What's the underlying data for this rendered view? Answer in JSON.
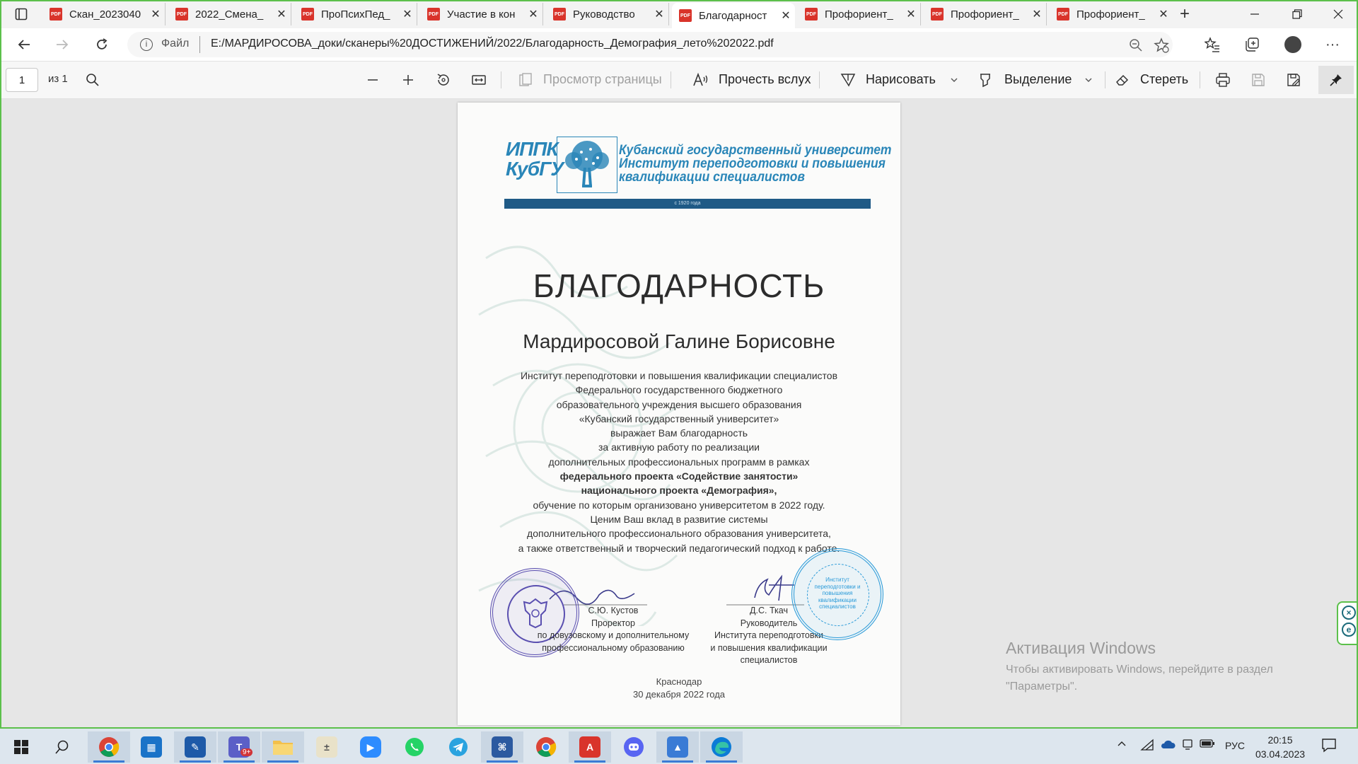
{
  "browser": {
    "tabs": [
      {
        "title": "Скан_2023040",
        "active": false
      },
      {
        "title": "2022_Смена_",
        "active": false
      },
      {
        "title": "ПроПсихПед_",
        "active": false
      },
      {
        "title": "Участие в кон",
        "active": false
      },
      {
        "title": "Руководство",
        "active": false
      },
      {
        "title": "Благодарност",
        "active": true
      },
      {
        "title": "Профориент_",
        "active": false
      },
      {
        "title": "Профориент_",
        "active": false
      },
      {
        "title": "Профориент_",
        "active": false
      }
    ],
    "tab_icon_label": "PDF",
    "new_tab_label": "+",
    "address": {
      "file_label": "Файл",
      "url": "E:/МАРДИРОСОВА_доки/сканеры%20ДОСТИЖЕНИЙ/2022/Благодарность_Демография_лето%202022.pdf"
    }
  },
  "pdf_toolbar": {
    "page_number": "1",
    "page_of": "из 1",
    "page_view_label": "Просмотр страницы",
    "read_aloud_label": "Прочесть вслух",
    "draw_label": "Нарисовать",
    "highlight_label": "Выделение",
    "erase_label": "Стереть"
  },
  "document": {
    "logo_abbr_1": "ИППК",
    "logo_abbr_2": "КубГУ",
    "univ_line_1": "Кубанский государственный университет",
    "univ_line_2": "Институт переподготовки и повышения",
    "univ_line_3": "квалификации специалистов",
    "ribbon_text": "с 1920 года",
    "title": "БЛАГОДАРНОСТЬ",
    "recipient": "Мардиросовой Галине Борисовне",
    "body_lines": [
      "Институт переподготовки и повышения квалификации специалистов",
      "Федерального государственного бюджетного",
      "образовательного учреждения высшего образования",
      "«Кубанский государственный университет»",
      "выражает Вам благодарность",
      "за активную работу по реализации",
      "дополнительных профессиональных программ в рамках"
    ],
    "bold_lines": [
      "федерального проекта «Содействие занятости»",
      "национального проекта «Демография»,"
    ],
    "tail_lines": [
      "обучение по которым организовано университетом в 2022 году.",
      "Ценим Ваш вклад в развитие системы",
      "дополнительного профессионального образования университета,",
      "а также ответственный и творческий педагогический подход к работе."
    ],
    "signer_left": {
      "name": "С.Ю. Кустов",
      "role_1": "Проректор",
      "role_2": "по довузовскому и дополнительному",
      "role_3": "профессиональному образованию"
    },
    "signer_right": {
      "name": "Д.С. Ткач",
      "role_1": "Руководитель",
      "role_2": "Института переподготовки",
      "role_3": "и повышения квалификации",
      "role_4": "специалистов"
    },
    "stamp_right_text": "Институт переподготовки и повышения квалификации специалистов",
    "city": "Краснодар",
    "date": "30 декабря 2022 года"
  },
  "windows_watermark": {
    "title": "Активация Windows",
    "line_1": "Чтобы активировать Windows, перейдите в раздел",
    "line_2": "\"Параметры\"."
  },
  "taskbar": {
    "apps": [
      "start",
      "search",
      "chrome",
      "calendar",
      "document-editor",
      "teams",
      "file-explorer",
      "calculator",
      "zoom",
      "whatsapp",
      "telegram",
      "app-generic",
      "chrome",
      "acrobat",
      "discord",
      "photos",
      "edge"
    ],
    "teams_badge": "9+",
    "language": "РУС",
    "time": "20:15",
    "date": "03.04.2023"
  },
  "colors": {
    "accent_green": "#5cc04b",
    "pdf_red": "#d9342b",
    "brand_blue": "#2a86b8",
    "stamp_purple": "#5a4fb0",
    "stamp_blue": "#2a9ad8"
  }
}
